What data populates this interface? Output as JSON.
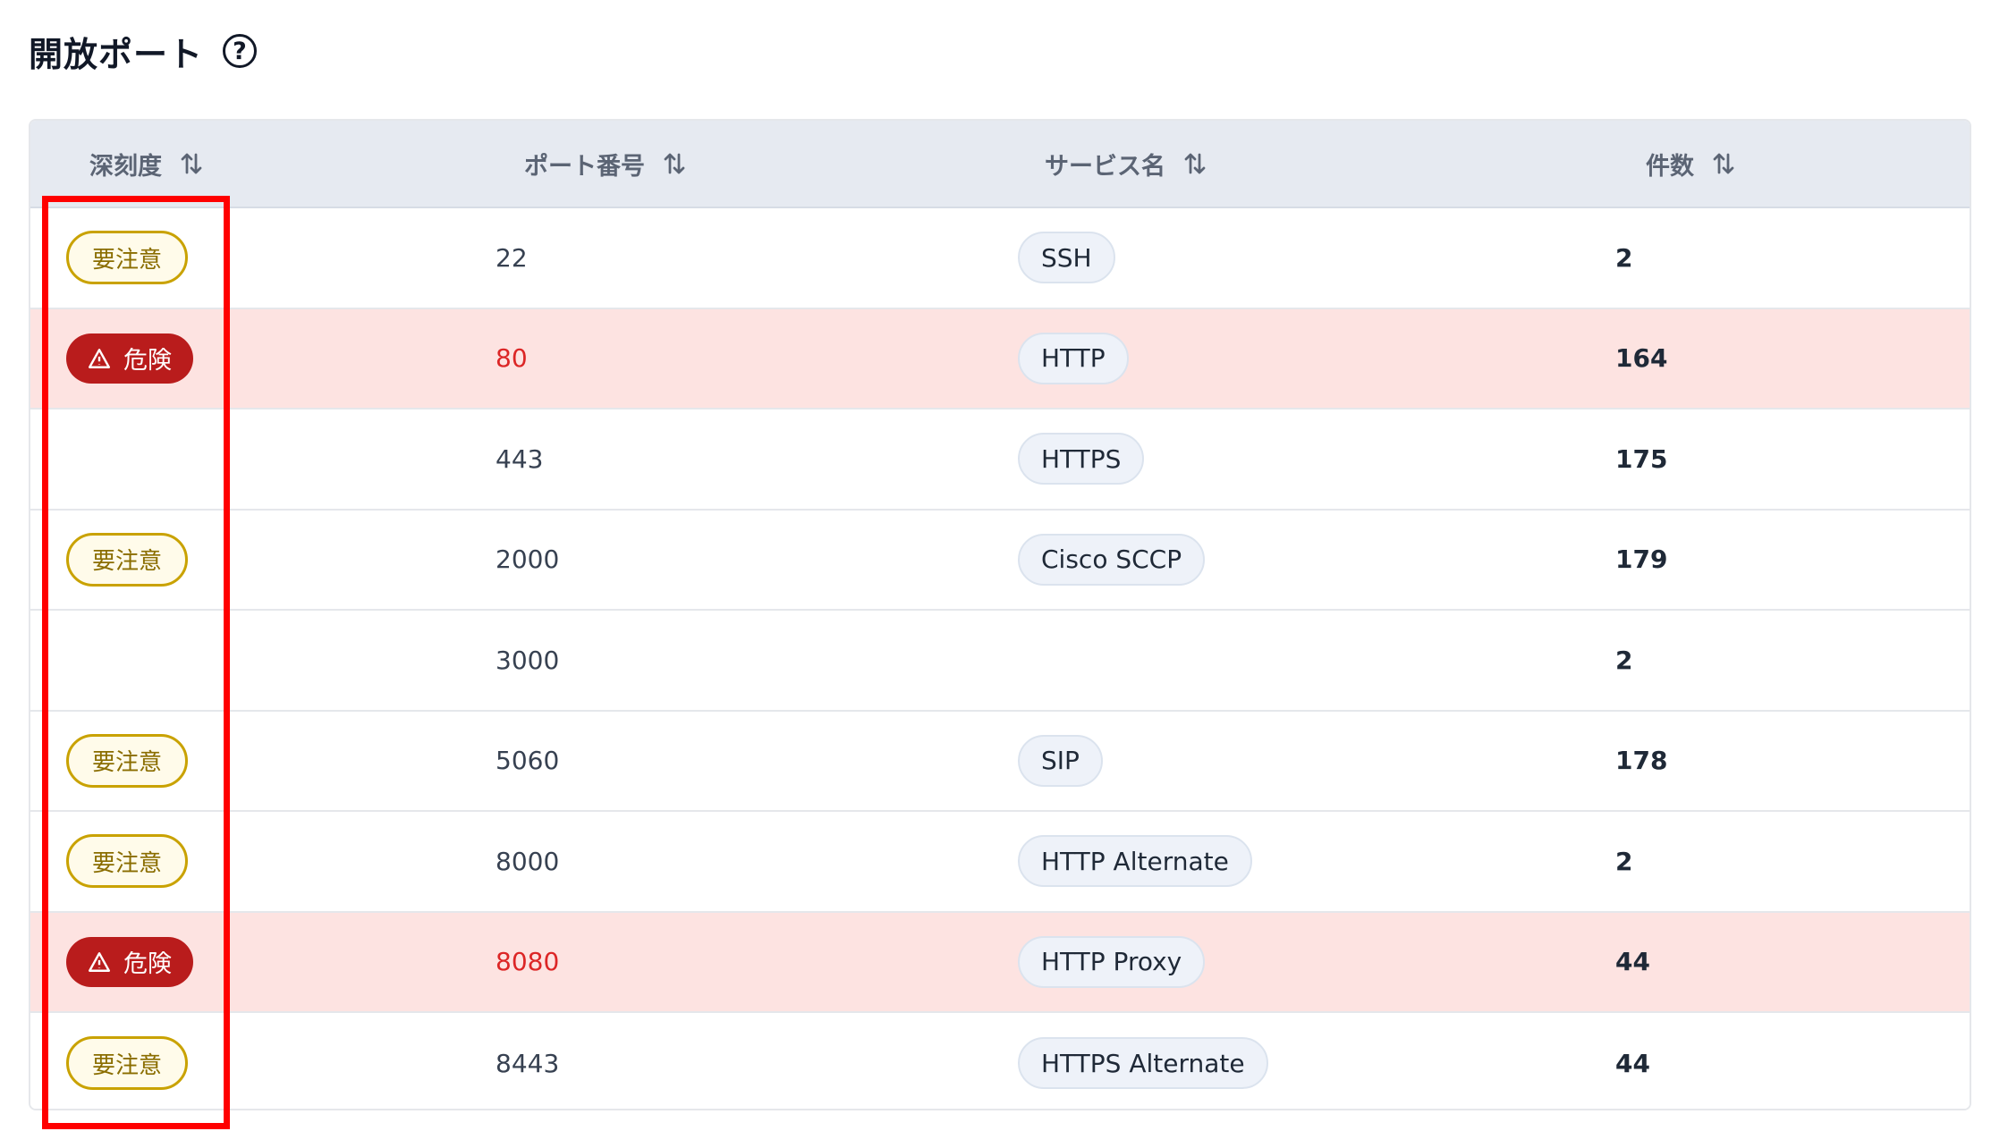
{
  "page": {
    "title": "開放ポート",
    "help_icon": "question-circle-icon"
  },
  "table": {
    "columns": [
      {
        "key": "severity",
        "label": "深刻度"
      },
      {
        "key": "port",
        "label": "ポート番号"
      },
      {
        "key": "service",
        "label": "サービス名"
      },
      {
        "key": "count",
        "label": "件数"
      }
    ],
    "sort_icon": "sort-arrows-icon",
    "severity_labels": {
      "caution": "要注意",
      "danger": "危険"
    },
    "rows": [
      {
        "severity": "caution",
        "severity_label": "要注意",
        "port": "22",
        "service": "SSH",
        "count": "2"
      },
      {
        "severity": "danger",
        "severity_label": "危険",
        "port": "80",
        "service": "HTTP",
        "count": "164"
      },
      {
        "severity": "none",
        "severity_label": "",
        "port": "443",
        "service": "HTTPS",
        "count": "175"
      },
      {
        "severity": "caution",
        "severity_label": "要注意",
        "port": "2000",
        "service": "Cisco SCCP",
        "count": "179"
      },
      {
        "severity": "none",
        "severity_label": "",
        "port": "3000",
        "service": "",
        "count": "2"
      },
      {
        "severity": "caution",
        "severity_label": "要注意",
        "port": "5060",
        "service": "SIP",
        "count": "178"
      },
      {
        "severity": "caution",
        "severity_label": "要注意",
        "port": "8000",
        "service": "HTTP Alternate",
        "count": "2"
      },
      {
        "severity": "danger",
        "severity_label": "危険",
        "port": "8080",
        "service": "HTTP Proxy",
        "count": "44"
      },
      {
        "severity": "caution",
        "severity_label": "要注意",
        "port": "8443",
        "service": "HTTPS Alternate",
        "count": "44"
      }
    ]
  },
  "colors": {
    "caution_border": "#c9a200",
    "danger_badge": "#b91c1c",
    "danger_row_bg": "#fde3e1",
    "danger_port_text": "#dc2626",
    "header_bg": "#e6eaf1",
    "annotation_red": "#ff0000"
  }
}
